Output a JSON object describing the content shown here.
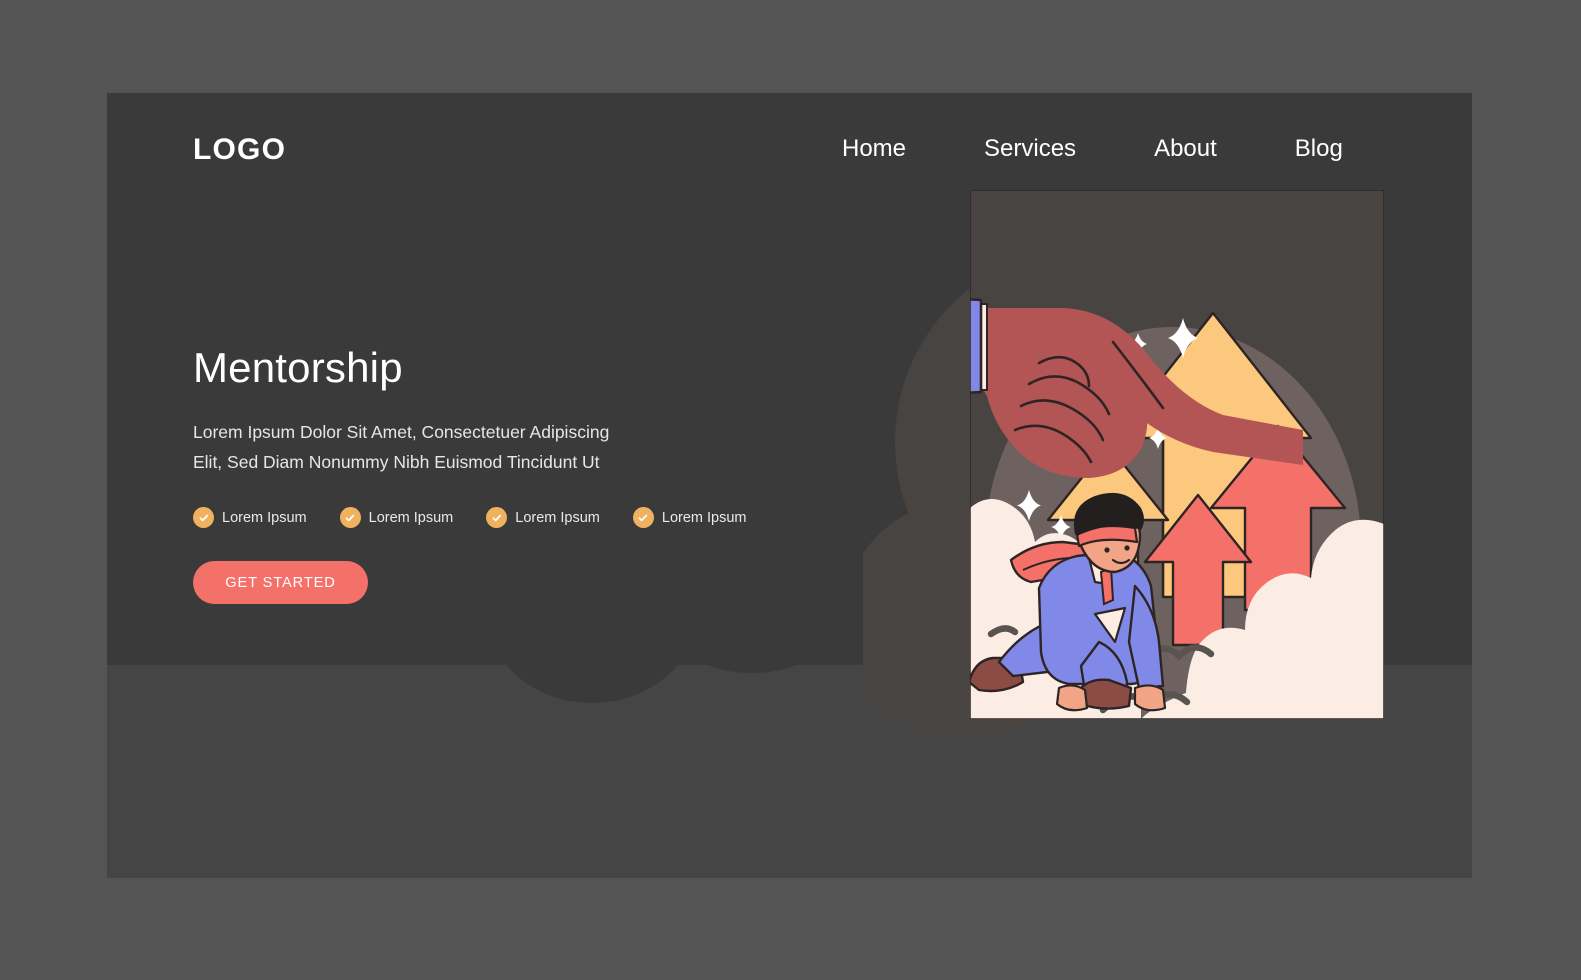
{
  "brand": {
    "logo_text": "LOGO"
  },
  "nav": {
    "items": [
      {
        "label": "Home"
      },
      {
        "label": "Services"
      },
      {
        "label": "About"
      },
      {
        "label": "Blog"
      }
    ]
  },
  "hero": {
    "title": "Mentorship",
    "subtitle": "Lorem Ipsum Dolor Sit Amet, Consectetuer Adipiscing Elit, Sed Diam Nonummy Nibh Euismod Tincidunt Ut",
    "features": [
      {
        "label": "Lorem Ipsum",
        "icon": "check-circle-icon"
      },
      {
        "label": "Lorem Ipsum",
        "icon": "check-circle-icon"
      },
      {
        "label": "Lorem Ipsum",
        "icon": "check-circle-icon"
      },
      {
        "label": "Lorem Ipsum",
        "icon": "check-circle-icon"
      }
    ],
    "cta_label": "GET STARTED"
  },
  "illustration": {
    "name": "mentorship-hand-and-runner-illustration",
    "elements": [
      "pointing-hand-icon",
      "blue-sleeve",
      "up-arrow-amber-large",
      "up-arrow-amber-small",
      "up-arrow-coral-large",
      "up-arrow-coral-small",
      "sparkle-icon",
      "crouching-businessman",
      "cloud-ground",
      "bird-icon"
    ]
  },
  "colors": {
    "canvas": "#545454",
    "panel": "#454545",
    "hero_band": "#3a3a3a",
    "cloud_dark": "#474442",
    "ellipse_mauve": "#6e6260",
    "accent_coral": "#f4716a",
    "accent_amber": "#fbc87d",
    "badge_amber": "#f0b25e",
    "suit_blue": "#8089e8",
    "hand_brick": "#b35555",
    "cream": "#fbede4",
    "outline": "#2e2424",
    "bird_gray": "#5a5450",
    "text_white": "#ffffff"
  }
}
